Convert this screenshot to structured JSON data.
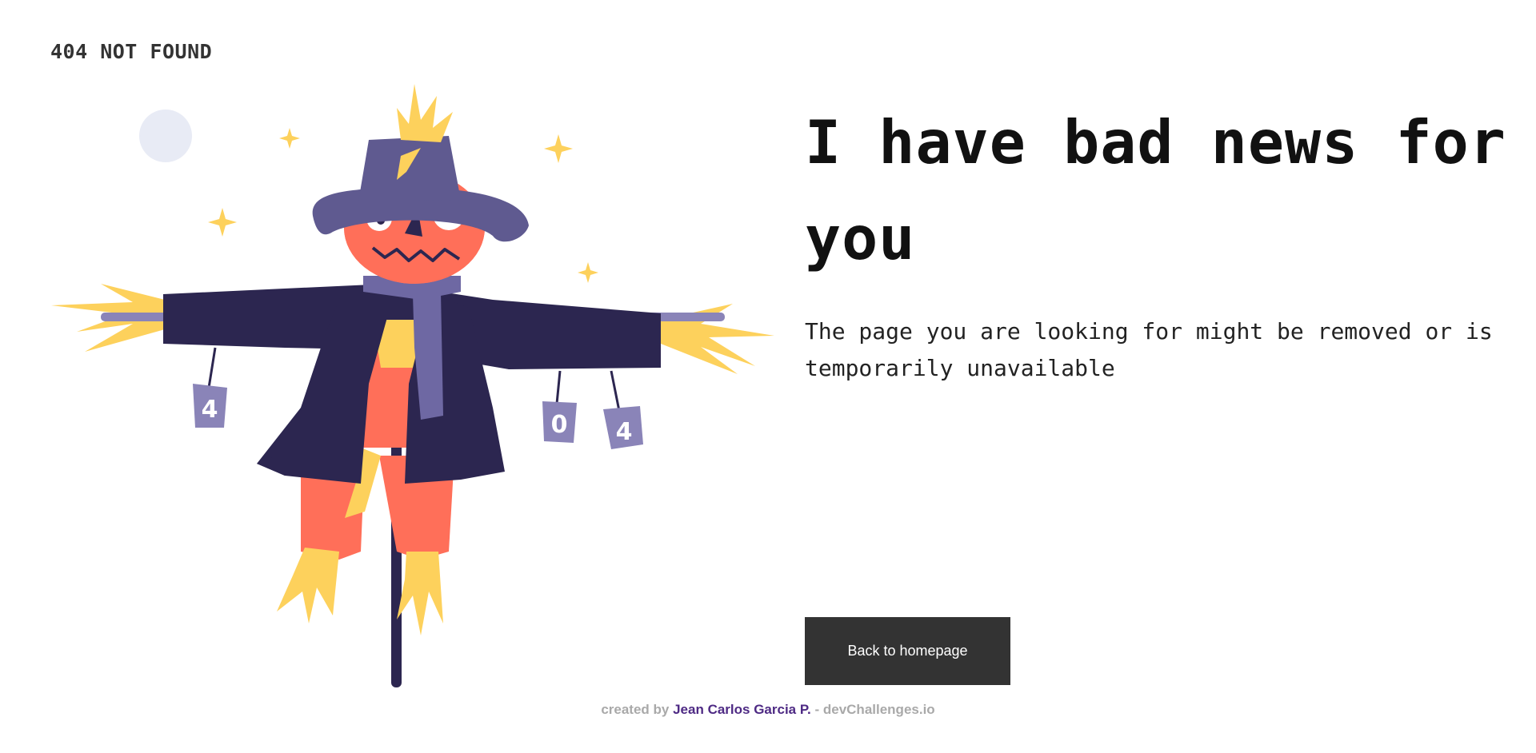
{
  "header": {
    "title": "404 NOT FOUND"
  },
  "main": {
    "headline": "I have bad news for you",
    "message": "The page you are looking for might be removed or is temporarily unavailable",
    "button_label": "Back to homepage"
  },
  "illustration": {
    "cans": [
      "4",
      "0",
      "4"
    ],
    "colors": {
      "hat": "#5f5a90",
      "coat": "#2c2650",
      "pumpkin": "#ff6f59",
      "straw": "#fdd15c",
      "scarf": "#6e68a3",
      "moon": "#e8ebf5",
      "can": "#8a84b8",
      "pole": "#2c2650"
    }
  },
  "footer": {
    "prefix": "created by",
    "author": "Jean Carlos Garcia P.",
    "separator": "-",
    "site": "devChallenges.io"
  }
}
